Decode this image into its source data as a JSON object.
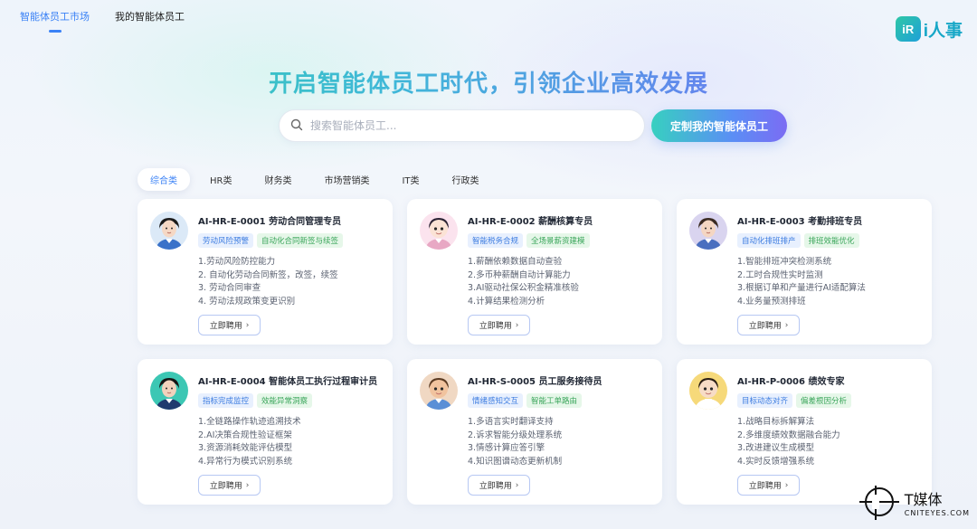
{
  "nav": {
    "tabs": [
      {
        "label": "智能体员工市场",
        "active": true
      },
      {
        "label": "我的智能体员工",
        "active": false
      }
    ]
  },
  "logo": {
    "badge": "iR",
    "text": "i人事"
  },
  "hero": {
    "title": "开启智能体员工时代，引领企业高效发展"
  },
  "search": {
    "placeholder": "搜索智能体员工..."
  },
  "cta": {
    "label": "定制我的智能体员工"
  },
  "categories": [
    {
      "label": "综合类",
      "active": true
    },
    {
      "label": "HR类",
      "active": false
    },
    {
      "label": "财务类",
      "active": false
    },
    {
      "label": "市场营销类",
      "active": false
    },
    {
      "label": "IT类",
      "active": false
    },
    {
      "label": "行政类",
      "active": false
    }
  ],
  "cards": [
    {
      "title": "AI-HR-E-0001 劳动合同管理专员",
      "tags": [
        "劳动风险预警",
        "自动化合同新签与续签"
      ],
      "features": [
        "1.劳动风险防控能力",
        "2. 自动化劳动合同新签，改签，续签",
        "3. 劳动合同审查",
        "4. 劳动法规政策变更识别"
      ],
      "button": "立即聘用",
      "avatar": {
        "bg": "#dbe9f7",
        "hair": "#1b1b1b",
        "shirt": "#3a72c9",
        "skin": "#f5d8c4",
        "cartoon": false
      }
    },
    {
      "title": "AI-HR-E-0002 薪酬核算专员",
      "tags": [
        "智能税务合规",
        "全场景薪资建模"
      ],
      "features": [
        "1.薪酬依赖数据自动查验",
        "2.多币种薪酬自动计算能力",
        "3.AI驱动社保公积金精准核验",
        "4.计算结果检测分析"
      ],
      "button": "立即聘用",
      "avatar": {
        "bg": "#fbe3ee",
        "hair": "#2a2233",
        "shirt": "#e8a8c4",
        "skin": "#fbe3d5",
        "cartoon": true
      }
    },
    {
      "title": "AI-HR-E-0003 考勤排班专员",
      "tags": [
        "自动化排班排产",
        "排班效能优化"
      ],
      "features": [
        "1.智能排班冲突检测系统",
        "2.工时合规性实时监测",
        "3.根据订单和产量进行AI适配算法",
        "4.业务量预测排班"
      ],
      "button": "立即聘用",
      "avatar": {
        "bg": "#d9d4ef",
        "hair": "#3a2a22",
        "shirt": "#4a6fbf",
        "skin": "#f4d6c2",
        "cartoon": false
      }
    },
    {
      "title": "AI-HR-E-0004 智能体员工执行过程审计员",
      "tags": [
        "指标完成监控",
        "效能异常洞察"
      ],
      "features": [
        "1.全链路操作轨迹追溯技术",
        "2.AI决策合规性验证框架",
        "3.资源消耗效能评估模型",
        "4.异常行为模式识别系统"
      ],
      "button": "立即聘用",
      "avatar": {
        "bg": "#3cc7b4",
        "hair": "#151515",
        "shirt": "#1f3b6e",
        "skin": "#f1d2bd",
        "cartoon": false
      }
    },
    {
      "title": "AI-HR-S-0005 员工服务接待员",
      "tags": [
        "情绪感知交互",
        "智能工单路由"
      ],
      "features": [
        "1.多语言实时翻译支持",
        "2.诉求智能分级处理系统",
        "3.情感计算应答引擎",
        "4.知识图谱动态更新机制"
      ],
      "button": "立即聘用",
      "avatar": {
        "bg": "#f0d8c3",
        "hair": "#5a3a22",
        "shirt": "#5b8fd6",
        "skin": "#f1c39e",
        "cartoon": true
      }
    },
    {
      "title": "AI-HR-P-0006 绩效专家",
      "tags": [
        "目标动态对齐",
        "偏差根因分析"
      ],
      "features": [
        "1.战略目标拆解算法",
        "2.多维度绩效数据融合能力",
        "3.改进建议生成模型",
        "4.实时反馈增强系统"
      ],
      "button": "立即聘用",
      "avatar": {
        "bg": "#f6d97a",
        "hair": "#2a1e14",
        "shirt": "#ffffff",
        "skin": "#f7dcc6",
        "cartoon": true
      }
    }
  ],
  "watermark": {
    "main": "T媒体",
    "sub": "CNITEYES.COM"
  },
  "colors": {
    "accent": "#3b82f6",
    "tagBlue": "#3b7be0",
    "tagGreen": "#3aa55a"
  }
}
